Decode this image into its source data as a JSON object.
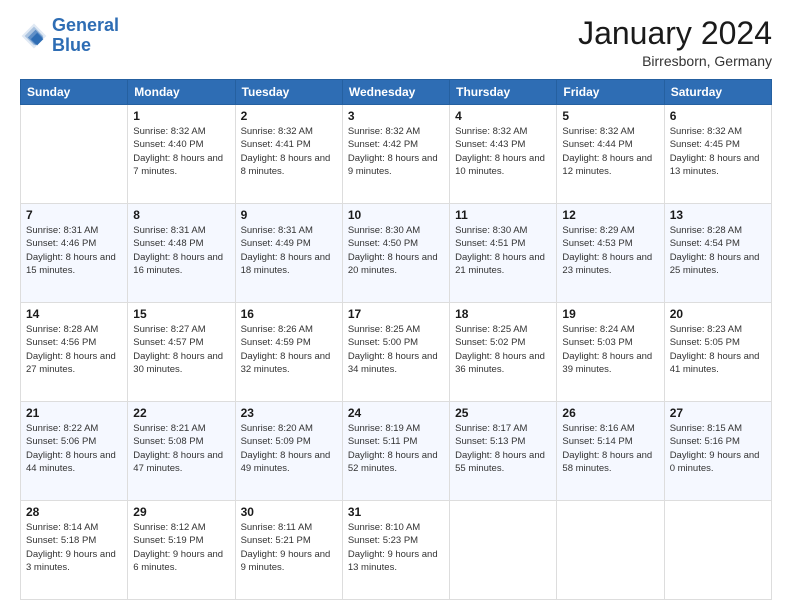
{
  "logo": {
    "line1": "General",
    "line2": "Blue"
  },
  "title": "January 2024",
  "location": "Birresborn, Germany",
  "weekdays": [
    "Sunday",
    "Monday",
    "Tuesday",
    "Wednesday",
    "Thursday",
    "Friday",
    "Saturday"
  ],
  "weeks": [
    [
      {
        "day": "",
        "sunrise": "",
        "sunset": "",
        "daylight": ""
      },
      {
        "day": "1",
        "sunrise": "Sunrise: 8:32 AM",
        "sunset": "Sunset: 4:40 PM",
        "daylight": "Daylight: 8 hours and 7 minutes."
      },
      {
        "day": "2",
        "sunrise": "Sunrise: 8:32 AM",
        "sunset": "Sunset: 4:41 PM",
        "daylight": "Daylight: 8 hours and 8 minutes."
      },
      {
        "day": "3",
        "sunrise": "Sunrise: 8:32 AM",
        "sunset": "Sunset: 4:42 PM",
        "daylight": "Daylight: 8 hours and 9 minutes."
      },
      {
        "day": "4",
        "sunrise": "Sunrise: 8:32 AM",
        "sunset": "Sunset: 4:43 PM",
        "daylight": "Daylight: 8 hours and 10 minutes."
      },
      {
        "day": "5",
        "sunrise": "Sunrise: 8:32 AM",
        "sunset": "Sunset: 4:44 PM",
        "daylight": "Daylight: 8 hours and 12 minutes."
      },
      {
        "day": "6",
        "sunrise": "Sunrise: 8:32 AM",
        "sunset": "Sunset: 4:45 PM",
        "daylight": "Daylight: 8 hours and 13 minutes."
      }
    ],
    [
      {
        "day": "7",
        "sunrise": "Sunrise: 8:31 AM",
        "sunset": "Sunset: 4:46 PM",
        "daylight": "Daylight: 8 hours and 15 minutes."
      },
      {
        "day": "8",
        "sunrise": "Sunrise: 8:31 AM",
        "sunset": "Sunset: 4:48 PM",
        "daylight": "Daylight: 8 hours and 16 minutes."
      },
      {
        "day": "9",
        "sunrise": "Sunrise: 8:31 AM",
        "sunset": "Sunset: 4:49 PM",
        "daylight": "Daylight: 8 hours and 18 minutes."
      },
      {
        "day": "10",
        "sunrise": "Sunrise: 8:30 AM",
        "sunset": "Sunset: 4:50 PM",
        "daylight": "Daylight: 8 hours and 20 minutes."
      },
      {
        "day": "11",
        "sunrise": "Sunrise: 8:30 AM",
        "sunset": "Sunset: 4:51 PM",
        "daylight": "Daylight: 8 hours and 21 minutes."
      },
      {
        "day": "12",
        "sunrise": "Sunrise: 8:29 AM",
        "sunset": "Sunset: 4:53 PM",
        "daylight": "Daylight: 8 hours and 23 minutes."
      },
      {
        "day": "13",
        "sunrise": "Sunrise: 8:28 AM",
        "sunset": "Sunset: 4:54 PM",
        "daylight": "Daylight: 8 hours and 25 minutes."
      }
    ],
    [
      {
        "day": "14",
        "sunrise": "Sunrise: 8:28 AM",
        "sunset": "Sunset: 4:56 PM",
        "daylight": "Daylight: 8 hours and 27 minutes."
      },
      {
        "day": "15",
        "sunrise": "Sunrise: 8:27 AM",
        "sunset": "Sunset: 4:57 PM",
        "daylight": "Daylight: 8 hours and 30 minutes."
      },
      {
        "day": "16",
        "sunrise": "Sunrise: 8:26 AM",
        "sunset": "Sunset: 4:59 PM",
        "daylight": "Daylight: 8 hours and 32 minutes."
      },
      {
        "day": "17",
        "sunrise": "Sunrise: 8:25 AM",
        "sunset": "Sunset: 5:00 PM",
        "daylight": "Daylight: 8 hours and 34 minutes."
      },
      {
        "day": "18",
        "sunrise": "Sunrise: 8:25 AM",
        "sunset": "Sunset: 5:02 PM",
        "daylight": "Daylight: 8 hours and 36 minutes."
      },
      {
        "day": "19",
        "sunrise": "Sunrise: 8:24 AM",
        "sunset": "Sunset: 5:03 PM",
        "daylight": "Daylight: 8 hours and 39 minutes."
      },
      {
        "day": "20",
        "sunrise": "Sunrise: 8:23 AM",
        "sunset": "Sunset: 5:05 PM",
        "daylight": "Daylight: 8 hours and 41 minutes."
      }
    ],
    [
      {
        "day": "21",
        "sunrise": "Sunrise: 8:22 AM",
        "sunset": "Sunset: 5:06 PM",
        "daylight": "Daylight: 8 hours and 44 minutes."
      },
      {
        "day": "22",
        "sunrise": "Sunrise: 8:21 AM",
        "sunset": "Sunset: 5:08 PM",
        "daylight": "Daylight: 8 hours and 47 minutes."
      },
      {
        "day": "23",
        "sunrise": "Sunrise: 8:20 AM",
        "sunset": "Sunset: 5:09 PM",
        "daylight": "Daylight: 8 hours and 49 minutes."
      },
      {
        "day": "24",
        "sunrise": "Sunrise: 8:19 AM",
        "sunset": "Sunset: 5:11 PM",
        "daylight": "Daylight: 8 hours and 52 minutes."
      },
      {
        "day": "25",
        "sunrise": "Sunrise: 8:17 AM",
        "sunset": "Sunset: 5:13 PM",
        "daylight": "Daylight: 8 hours and 55 minutes."
      },
      {
        "day": "26",
        "sunrise": "Sunrise: 8:16 AM",
        "sunset": "Sunset: 5:14 PM",
        "daylight": "Daylight: 8 hours and 58 minutes."
      },
      {
        "day": "27",
        "sunrise": "Sunrise: 8:15 AM",
        "sunset": "Sunset: 5:16 PM",
        "daylight": "Daylight: 9 hours and 0 minutes."
      }
    ],
    [
      {
        "day": "28",
        "sunrise": "Sunrise: 8:14 AM",
        "sunset": "Sunset: 5:18 PM",
        "daylight": "Daylight: 9 hours and 3 minutes."
      },
      {
        "day": "29",
        "sunrise": "Sunrise: 8:12 AM",
        "sunset": "Sunset: 5:19 PM",
        "daylight": "Daylight: 9 hours and 6 minutes."
      },
      {
        "day": "30",
        "sunrise": "Sunrise: 8:11 AM",
        "sunset": "Sunset: 5:21 PM",
        "daylight": "Daylight: 9 hours and 9 minutes."
      },
      {
        "day": "31",
        "sunrise": "Sunrise: 8:10 AM",
        "sunset": "Sunset: 5:23 PM",
        "daylight": "Daylight: 9 hours and 13 minutes."
      },
      {
        "day": "",
        "sunrise": "",
        "sunset": "",
        "daylight": ""
      },
      {
        "day": "",
        "sunrise": "",
        "sunset": "",
        "daylight": ""
      },
      {
        "day": "",
        "sunrise": "",
        "sunset": "",
        "daylight": ""
      }
    ]
  ]
}
